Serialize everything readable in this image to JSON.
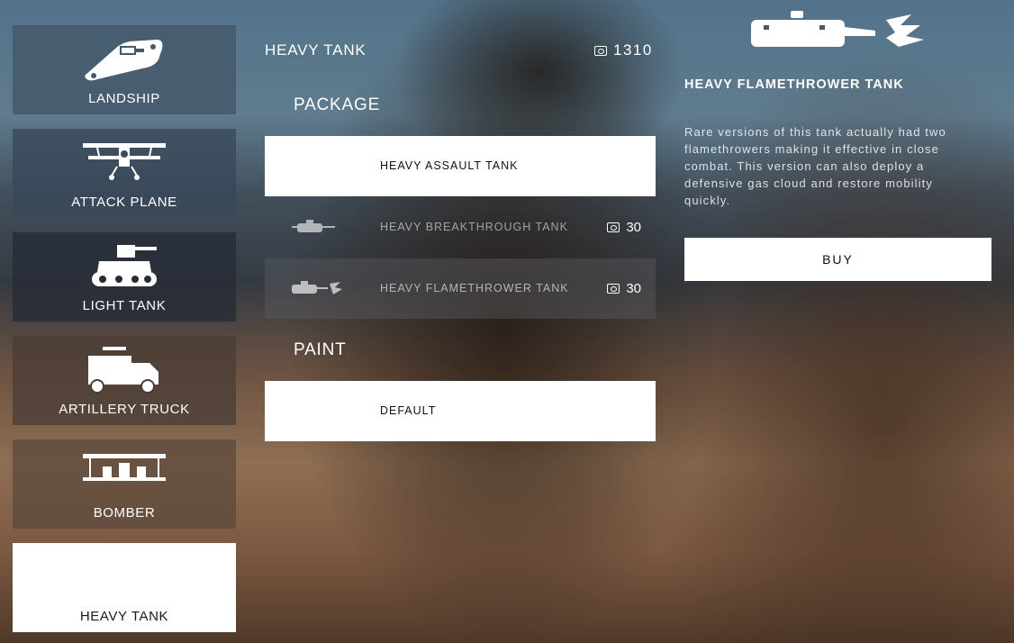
{
  "vehicles": [
    {
      "label": "LANDSHIP",
      "icon": "landship-icon"
    },
    {
      "label": "ATTACK PLANE",
      "icon": "attack-plane-icon"
    },
    {
      "label": "LIGHT TANK",
      "icon": "light-tank-icon"
    },
    {
      "label": "ARTILLERY TRUCK",
      "icon": "artillery-truck-icon"
    },
    {
      "label": "BOMBER",
      "icon": "bomber-icon"
    },
    {
      "label": "HEAVY TANK",
      "icon": "heavy-tank-icon",
      "selected": true
    }
  ],
  "main": {
    "title": "HEAVY TANK",
    "balance": "1310",
    "package_heading": "PACKAGE",
    "packages": [
      {
        "label": "HEAVY ASSAULT TANK",
        "price": ""
      },
      {
        "label": "HEAVY BREAKTHROUGH TANK",
        "price": "30",
        "icon": "breakthrough-tank-icon"
      },
      {
        "label": "HEAVY FLAMETHROWER TANK",
        "price": "30",
        "icon": "flamethrower-tank-icon"
      }
    ],
    "paint_heading": "PAINT",
    "paints": [
      {
        "label": "DEFAULT"
      }
    ]
  },
  "detail": {
    "icon": "flamethrower-tank-icon",
    "title": "HEAVY FLAMETHROWER TANK",
    "description": "Rare versions of this tank actually had two flamethrowers making it effective in close combat. This version can also deploy a defensive gas cloud and restore mobility quickly.",
    "buy_label": "BUY"
  },
  "colors": {
    "selected_bg": "#ffffff",
    "text": "#ffffff"
  }
}
